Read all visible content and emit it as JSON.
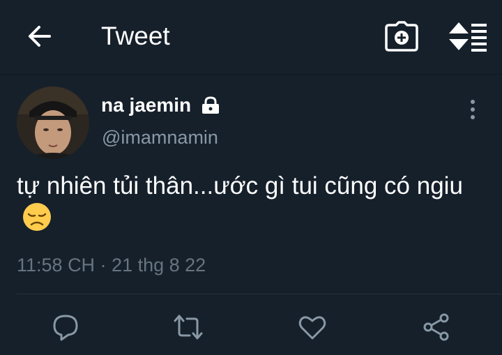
{
  "header": {
    "title": "Tweet",
    "back_icon": "arrow-left-icon",
    "compose_icon": "camera-icon",
    "sort_icon": "sort-icon"
  },
  "tweet": {
    "display_name": "na jaemin",
    "protected_icon": "lock-icon",
    "handle": "@imamnamin",
    "text": "tự nhiên tủi thân...ước gì tui cũng có ngiu",
    "emoji": "disappointed-face-emoji",
    "timestamp": "11:58 CH · 21 thg 8 22",
    "more_icon": "more-vertical-icon"
  },
  "actions": [
    {
      "name": "reply",
      "icon": "reply-icon"
    },
    {
      "name": "retweet",
      "icon": "retweet-icon"
    },
    {
      "name": "like",
      "icon": "heart-icon"
    },
    {
      "name": "share",
      "icon": "share-icon"
    }
  ],
  "colors": {
    "background": "#16202b",
    "secondary_text": "#8899a6",
    "timestamp_text": "#66757f",
    "icon_gray": "#8899a6"
  }
}
